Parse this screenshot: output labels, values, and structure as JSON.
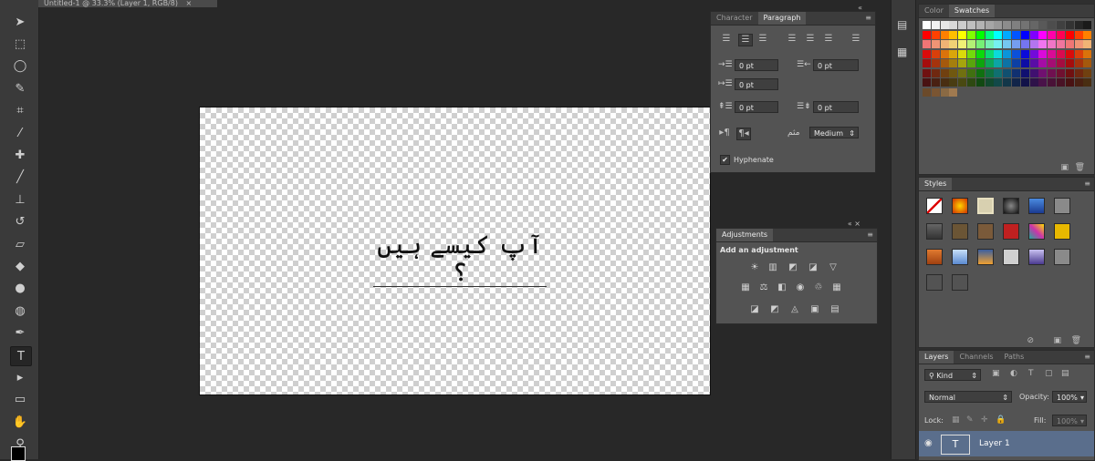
{
  "document": {
    "tab_title": "Untitled-1 @ 33.3% (Layer 1, RGB/8)",
    "close": "×"
  },
  "canvas": {
    "text": "آپ کیسے ہیں ؟"
  },
  "tools": [
    {
      "name": "move-tool-icon",
      "glyph": "➤"
    },
    {
      "name": "marquee-tool-icon",
      "glyph": "⬚"
    },
    {
      "name": "lasso-tool-icon",
      "glyph": "◯"
    },
    {
      "name": "quick-select-tool-icon",
      "glyph": "✎"
    },
    {
      "name": "crop-tool-icon",
      "glyph": "⌗"
    },
    {
      "name": "eyedropper-tool-icon",
      "glyph": "⁄"
    },
    {
      "name": "healing-brush-tool-icon",
      "glyph": "✚"
    },
    {
      "name": "brush-tool-icon",
      "glyph": "╱"
    },
    {
      "name": "clone-stamp-tool-icon",
      "glyph": "⊥"
    },
    {
      "name": "history-brush-tool-icon",
      "glyph": "↺"
    },
    {
      "name": "eraser-tool-icon",
      "glyph": "▱"
    },
    {
      "name": "paint-bucket-tool-icon",
      "glyph": "◆"
    },
    {
      "name": "blur-tool-icon",
      "glyph": "●"
    },
    {
      "name": "dodge-tool-icon",
      "glyph": "◍"
    },
    {
      "name": "pen-tool-icon",
      "glyph": "✒"
    },
    {
      "name": "type-tool-icon",
      "glyph": "T"
    },
    {
      "name": "path-selection-tool-icon",
      "glyph": "▸"
    },
    {
      "name": "rectangle-tool-icon",
      "glyph": "▭"
    },
    {
      "name": "hand-tool-icon",
      "glyph": "✋"
    },
    {
      "name": "zoom-tool-icon",
      "glyph": "⚲"
    }
  ],
  "paragraph_panel": {
    "tabs": [
      "Character",
      "Paragraph"
    ],
    "indent_left": "0 pt",
    "indent_right": "0 pt",
    "indent_first": "0 pt",
    "space_before": "0 pt",
    "space_after": "0 pt",
    "kashida_label": "مثم",
    "kashida_value": "Medium",
    "hyphenate_label": "Hyphenate",
    "hyphenate_checked": "✔"
  },
  "adjustments_panel": {
    "title": "Adjustments",
    "subtitle": "Add an adjustment"
  },
  "swatches_panel": {
    "tabs": [
      "Color",
      "Swatches"
    ]
  },
  "styles_panel": {
    "title": "Styles"
  },
  "layers_panel": {
    "tabs": [
      "Layers",
      "Channels",
      "Paths"
    ],
    "kind_label": "Kind",
    "blend_mode": "Normal",
    "opacity_label": "Opacity:",
    "opacity_value": "100%",
    "lock_label": "Lock:",
    "fill_label": "Fill:",
    "fill_value": "100%",
    "layer_name": "Layer 1",
    "layer_thumb": "T"
  },
  "colors": {
    "panel_bg": "#535353",
    "workspace_bg": "#282828",
    "selected_layer": "#5a6e8c"
  }
}
